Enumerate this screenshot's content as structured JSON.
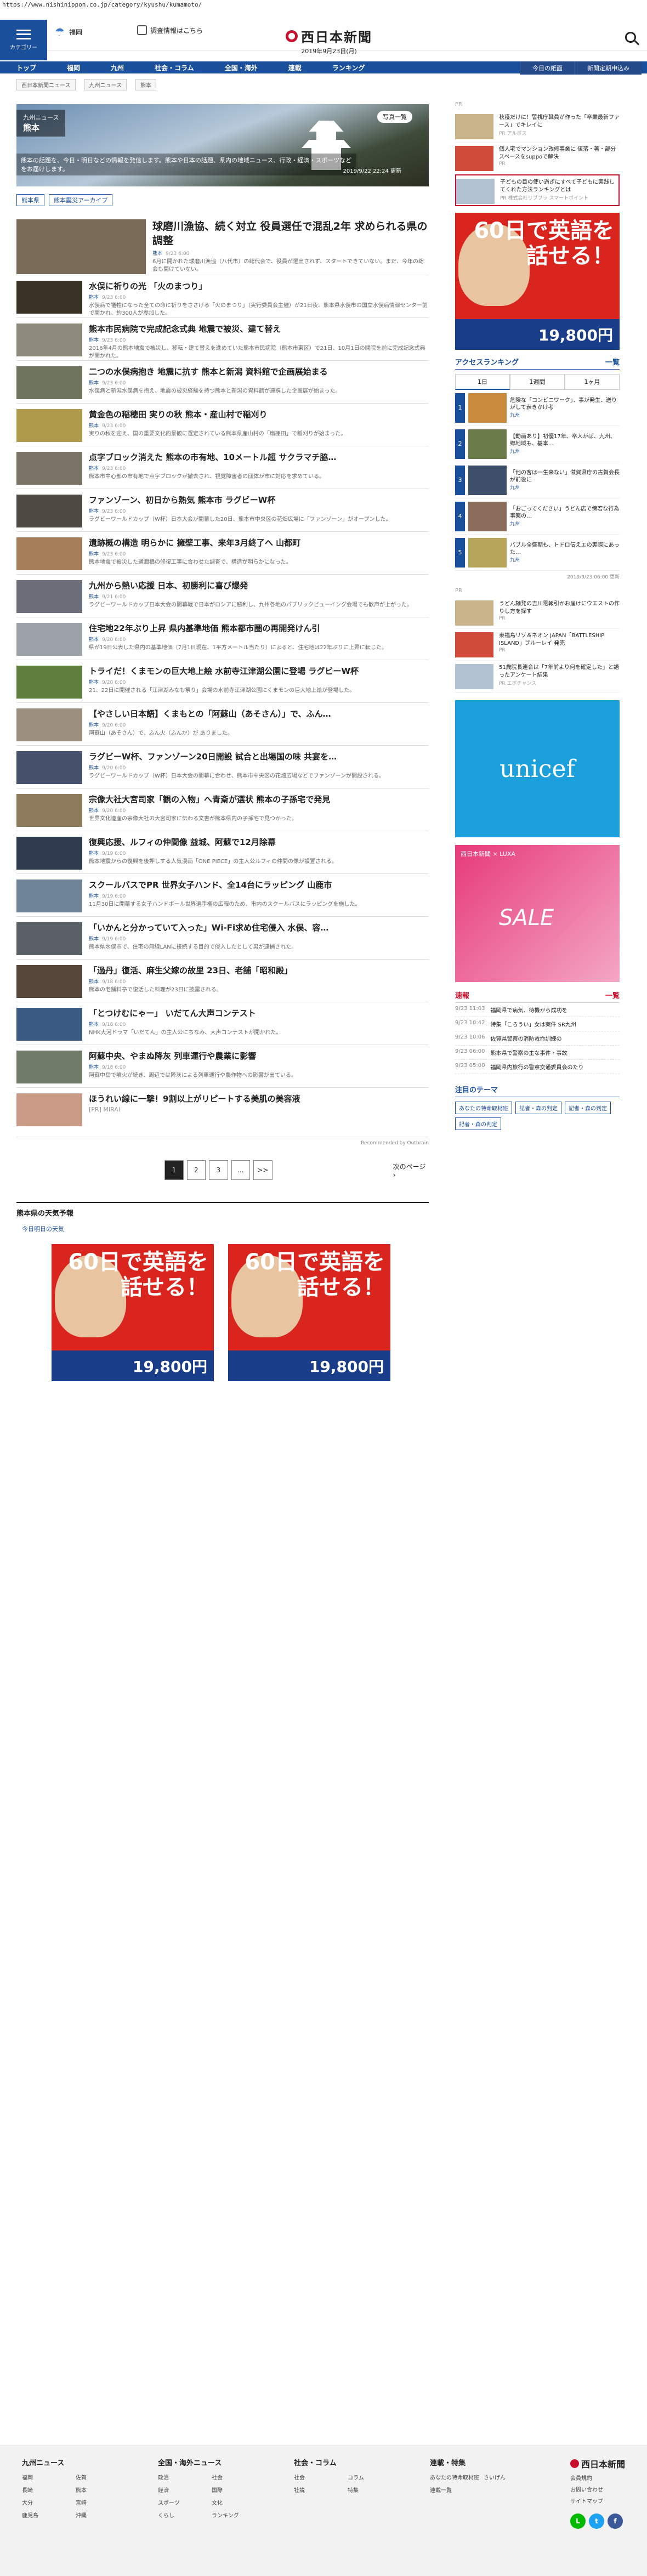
{
  "url": "https://www.nishinippon.co.jp/category/kyushu/kumamoto/",
  "header": {
    "menu_label": "カテゴリー",
    "weather": "福岡",
    "quiz": "調査情報はこちら",
    "logo": "西日本新聞",
    "date": "2019年9月23日(月)"
  },
  "nav": {
    "items": [
      "トップ",
      "福岡",
      "九州",
      "社会・コラム",
      "全国・海外",
      "連載",
      "ランキング"
    ],
    "right": [
      "今日の紙面",
      "新聞定期申込み"
    ]
  },
  "crumbs": [
    "西日本新聞ニュース",
    "九州ニュース",
    "熊本"
  ],
  "hero": {
    "label_small": "九州ニュース",
    "label_big": "熊本",
    "desc": "熊本の話題を、今日・明日などの情報を発信します。熊本や日本の話題、県内の地域ニュース、行政・経済・スポーツなどをお届けします。",
    "time": "2019/9/22 22:24 更新",
    "photo_btn": "写真一覧"
  },
  "tags": [
    "熊本県",
    "熊本震災アーカイブ"
  ],
  "articles": [
    {
      "title": "球磨川漁協、続く対立 役員選任で混乱2年 求められる県の調整",
      "cat": "熊本",
      "time": "9/23 6:00",
      "sum": "6月に開かれた球磨川漁協（八代市）の総代会で、役員が選出されず、スタートできていない。まだ、今年の総会も開けていない。"
    },
    {
      "title": "水俣に祈りの光 「火のまつり」",
      "cat": "熊本",
      "time": "9/23 6:00",
      "sum": "水俣病で犠牲になった全ての命に祈りをささげる「火のまつり」（実行委員会主催）が21日夜、熊本県水俣市の国立水俣病情報センター前で開かれ、約300人が参加した。"
    },
    {
      "title": "熊本市民病院で完成記念式典 地震で被災、建て替え",
      "cat": "熊本",
      "time": "9/23 6:00",
      "sum": "2016年4月の熊本地震で被災し、移転・建て替えを進めていた熊本市民病院（熊本市東区）で21日、10月1日の開院を前に完成記念式典が開かれた。"
    },
    {
      "title": "二つの水俣病抱き 地震に抗す 熊本と新潟 資料館で企画展始まる",
      "cat": "熊本",
      "time": "9/23 6:00",
      "sum": "水俣病と新潟水俣病を抱え、地震の被災経験を持つ熊本と新潟の資料館が連携した企画展が始まった。"
    },
    {
      "title": "黄金色の稲穂田 実りの秋 熊本・産山村で稲刈り",
      "cat": "熊本",
      "time": "9/23 6:00",
      "sum": "実りの秋を迎え、国の重要文化的景観に選定されている熊本県産山村の「扇棚田」で稲刈りが始まった。"
    },
    {
      "title": "点字ブロック消えた 熊本の市有地、10メートル超 サクラマチ脇…",
      "cat": "熊本",
      "time": "9/23 6:00",
      "sum": "熊本市中心部の市有地で点字ブロックが撤去され、視覚障害者の団体が市に対応を求めている。"
    },
    {
      "title": "ファンゾーン、初日から熱気 熊本市 ラグビーW杯",
      "cat": "熊本",
      "time": "9/23 6:00",
      "sum": "ラグビーワールドカップ（W杯）日本大会が開幕した20日、熊本市中央区の花畑広場に「ファンゾーン」がオープンした。"
    },
    {
      "title": "遺跡概の構造 明らかに 擁壁工事、来年3月終了へ 山都町",
      "cat": "熊本",
      "time": "9/23 6:00",
      "sum": "熊本地震で被災した通潤橋の修復工事に合わせた調査で、構造が明らかになった。"
    },
    {
      "title": "九州から熱い応援 日本、初勝利に喜び爆発",
      "cat": "熊本",
      "time": "9/21 6:00",
      "sum": "ラグビーワールドカップ日本大会の開幕戦で日本がロシアに勝利し、九州各地のパブリックビューイング会場でも歓声が上がった。"
    },
    {
      "title": "住宅地22年ぶり上昇 県内基準地価 熊本都市圏の再開発けん引",
      "cat": "熊本",
      "time": "9/20 6:00",
      "sum": "県が19日公表した県内の基準地価（7月1日現在、1平方メートル当たり）によると、住宅地は22年ぶりに上昇に転じた。"
    },
    {
      "title": "トライだ！くまモンの巨大地上絵 水前寺江津湖公園に登場 ラグビーW杯",
      "cat": "熊本",
      "time": "9/20 6:00",
      "sum": "21、22日に開催される「江津湖みなも祭り」会場の水前寺江津湖公園にくまモンの巨大地上絵が登場した。"
    },
    {
      "title": "【やさしい日本語】くまもとの「阿蘇山（あそさん）」で、ふん…",
      "cat": "熊本",
      "time": "9/20 6:00",
      "sum": "阿蘇山（あそさん）で、ふん火（ふんか）が ありました。"
    },
    {
      "title": "ラグビーW杯、ファンゾーン20日開設 試合と出場国の味 共宴を…",
      "cat": "熊本",
      "time": "9/20 6:00",
      "sum": "ラグビーワールドカップ（W杯）日本大会の開幕に合わせ、熊本市中央区の花畑広場などでファンゾーンが開設される。"
    },
    {
      "title": "宗像大社大宮司家「観の入物」へ青斎が選状 熊本の子孫宅で発見",
      "cat": "熊本",
      "time": "9/20 6:00",
      "sum": "世界文化遺産の宗像大社の大宮司家に伝わる文書が熊本県内の子孫宅で見つかった。"
    },
    {
      "title": "復興応援、ルフィの仲間像 益城、阿蘇で12月除幕",
      "cat": "熊本",
      "time": "9/19 6:00",
      "sum": "熊本地震からの復興を後押しする人気漫画「ONE PIECE」の主人公ルフィの仲間の像が設置される。"
    },
    {
      "title": "スクールバスでPR 世界女子ハンド、全14台にラッピング 山鹿市",
      "cat": "熊本",
      "time": "9/19 6:00",
      "sum": "11月30日に開幕する女子ハンドボール世界選手権の広報のため、市内のスクールバスにラッピングを施した。"
    },
    {
      "title": "「いかんと分かっていて入った」Wi-Fi求め住宅侵入 水俣、容…",
      "cat": "熊本",
      "time": "9/19 6:00",
      "sum": "熊本県水俣市で、住宅の無線LANに接続する目的で侵入したとして男が逮捕された。"
    },
    {
      "title": "「過丹」復活、麻生父嫁の故里 23日、老舗「昭和殿」",
      "cat": "熊本",
      "time": "9/18 6:00",
      "sum": "熊本の老舗料亭で復活した料理が23日に披露される。"
    },
    {
      "title": "「とつけむにゃー」 いだてん大声コンテスト",
      "cat": "熊本",
      "time": "9/18 6:00",
      "sum": "NHK大河ドラマ「いだてん」の主人公にちなみ、大声コンテストが開かれた。"
    },
    {
      "title": "阿蘇中央、やまぬ降灰 列車運行や農業に影響",
      "cat": "熊本",
      "time": "9/18 6:00",
      "sum": "阿蘇中岳で噴火が続き、周辺では降灰による列車運行や農作物への影響が出ている。"
    }
  ],
  "ad_article": {
    "title": "ほうれい線に一撃！9割以上がリピートする美肌の美容液",
    "pr": "[PR] MIRAI"
  },
  "recommend": "Recommended by Outbrain",
  "pager": {
    "pages": [
      "1",
      "2",
      "3",
      "…",
      ">>"
    ],
    "next": "次のページ"
  },
  "weather_sec": {
    "title": "熊本県の天気予報",
    "sub": "今日明日の天気"
  },
  "ad60": {
    "big": "60日で英語を話せる！",
    "price": "19,800円"
  },
  "side": {
    "pr_label": "PR",
    "ads": [
      {
        "text": "秋穫だけに！警視庁職員が作った「卒業最新ファース」でキレイに",
        "by": "PR アルポス"
      },
      {
        "text": "個人宅でマンション改修事業に 値落・著・部分スペースをsuppoで解決",
        "by": "PR"
      },
      {
        "text": "子どもの目の使い過ぎにすべて子どもに実践してくれた方法ランキングとは",
        "by": "PR 株式会社リブフラ スマートポイント"
      }
    ],
    "ranking": {
      "title": "アクセスランキング",
      "more": "一覧",
      "tabs": [
        "1日",
        "1週間",
        "1ヶ月"
      ],
      "items": [
        {
          "text": "危険な「コンビニワーク」、事が発生、送りがして表きかけ考",
          "meta": "九州"
        },
        {
          "text": "【動画あり】初優17年、卒人がぱ、九州、郷地域も、基本…",
          "meta": "九州"
        },
        {
          "text": "「他の客は一生来ない」滋賀県庁の古賀会長が前後に",
          "meta": "九州"
        },
        {
          "text": "「おごってください」うどん店で傍若な行為 事案の…",
          "meta": "九州"
        },
        {
          "text": "バブル全盛期も、トドロ伝えエの実際にあった…",
          "meta": "九州"
        }
      ],
      "stamp": "2019/9/23 06:00 更新"
    },
    "ads2": [
      {
        "text": "うどん麺発の吉川電報引かお届けにウエストの作りし方を探す",
        "by": "PR"
      },
      {
        "text": "東福島リゾ＆ネオン JAPAN「BATTLESHIP ISLAND」ブルーレイ 発売",
        "by": "PR"
      },
      {
        "text": "51歳院長連合は「7年前より何を確定した」と語ったアンケート結果",
        "by": "PR エポチャンス"
      }
    ],
    "unicef": "unicef",
    "sale": {
      "t": "西日本新聞 × LUXA",
      "s": "SALE"
    },
    "flash": {
      "title": "速報",
      "more": "一覧",
      "items": [
        {
          "t": "9/23 11:03",
          "x": "福岡県で病気、待機から成功を"
        },
        {
          "t": "9/23 10:42",
          "x": "特集「ころうい」女は案件 SR九州"
        },
        {
          "t": "9/23 10:06",
          "x": "佐賀県警察の消防救命訓練の"
        },
        {
          "t": "9/23 06:00",
          "x": "熊本県で警察の主な事件・事故"
        },
        {
          "t": "9/23 05:00",
          "x": "福岡県内旅行の警察交通委員会のたり"
        }
      ]
    },
    "themes": {
      "title": "注目のテーマ",
      "items": [
        "あなたの特命取材班",
        "記者・森の判定",
        "記者・森の判定",
        "記者・森の判定"
      ]
    }
  },
  "footer": {
    "cols": [
      {
        "h": "九州ニュース",
        "items": [
          "福岡",
          "佐賀",
          "長崎",
          "熊本",
          "大分",
          "宮崎",
          "鹿児島",
          "沖縄"
        ]
      },
      {
        "h": "全国・海外ニュース",
        "items": [
          "政治",
          "社会",
          "経済",
          "国際",
          "スポーツ",
          "文化",
          "くらし",
          "ランキング"
        ]
      },
      {
        "h": "社会・コラム",
        "items": [
          "社会",
          "コラム",
          "社説",
          "特集"
        ]
      },
      {
        "h": "連載・特集",
        "items": [
          "あなたの特命取材班",
          "さいげん",
          "連載一覧"
        ]
      }
    ],
    "logo": "西日本新聞",
    "links": [
      "会員規約",
      "お問い合わせ",
      "サイトマップ"
    ]
  }
}
